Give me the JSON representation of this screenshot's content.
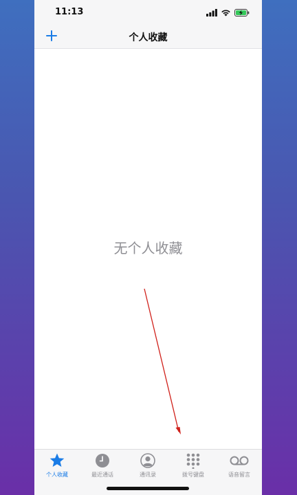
{
  "status_bar": {
    "time": "11:13"
  },
  "nav": {
    "title": "个人收藏"
  },
  "content": {
    "empty_message": "无个人收藏"
  },
  "tabs": [
    {
      "label": "个人收藏",
      "icon": "star-icon",
      "active": true
    },
    {
      "label": "最近通话",
      "icon": "clock-icon",
      "active": false
    },
    {
      "label": "通讯录",
      "icon": "contact-icon",
      "active": false
    },
    {
      "label": "拨号键盘",
      "icon": "keypad-icon",
      "active": false
    },
    {
      "label": "语音留言",
      "icon": "voicemail-icon",
      "active": false
    }
  ],
  "colors": {
    "accent": "#1a7ce6",
    "inactive": "#8e8e93",
    "annotation_arrow": "#d0201a"
  }
}
